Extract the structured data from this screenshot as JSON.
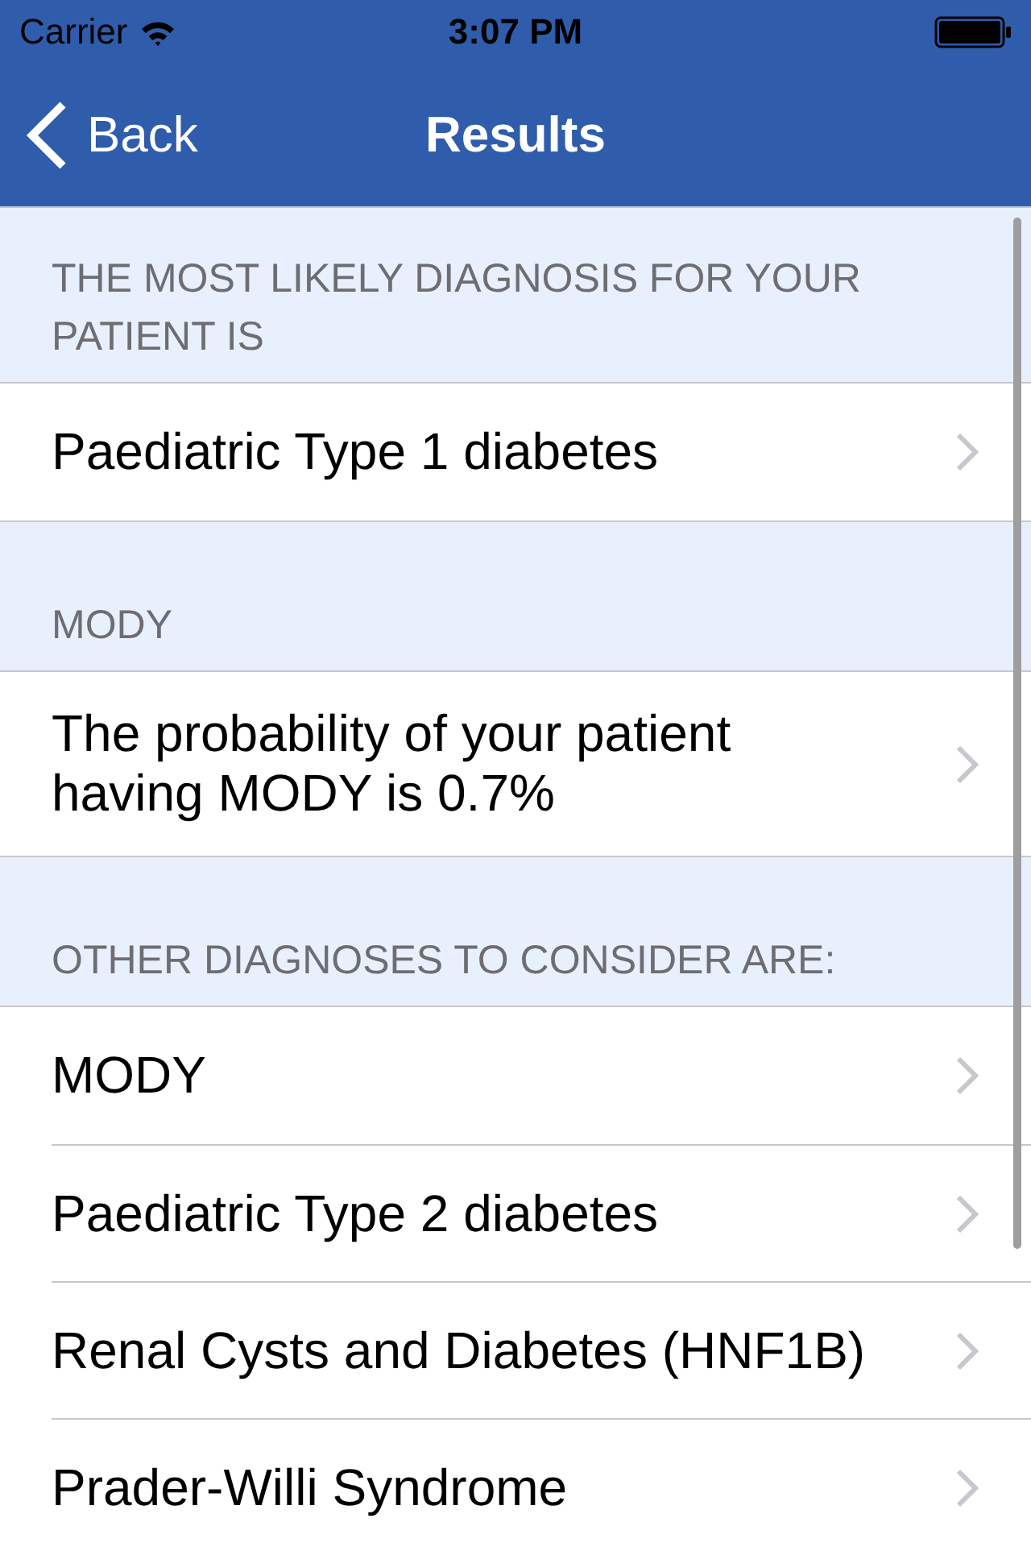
{
  "status_bar": {
    "carrier": "Carrier",
    "time": "3:07 PM"
  },
  "nav_bar": {
    "back": "Back",
    "title": "Results"
  },
  "sections": [
    {
      "header": "THE MOST LIKELY DIAGNOSIS FOR YOUR PATIENT IS",
      "rows": [
        {
          "label": "Paediatric Type 1 diabetes"
        }
      ]
    },
    {
      "header": "MODY",
      "rows": [
        {
          "label": "The probability of your patient having MODY is 0.7%"
        }
      ]
    },
    {
      "header": "OTHER DIAGNOSES TO CONSIDER ARE:",
      "rows": [
        {
          "label": "MODY"
        },
        {
          "label": "Paediatric Type 2 diabetes"
        },
        {
          "label": "Renal Cysts and Diabetes (HNF1B)"
        },
        {
          "label": "Prader-Willi Syndrome"
        }
      ]
    }
  ]
}
